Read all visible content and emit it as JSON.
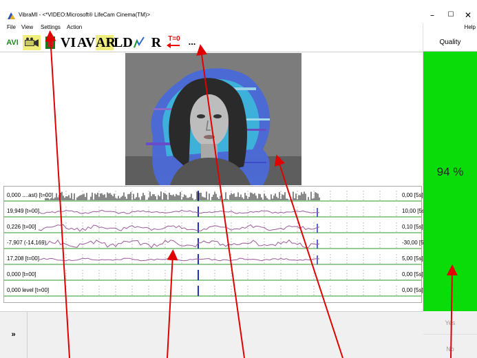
{
  "window": {
    "title": "VibraMI - <*VIDEO:Microsoft® LifeCam Cinema(TM)>",
    "min_glyph": "–",
    "max_glyph": "☐",
    "close_glyph": "✕"
  },
  "menu": {
    "items": [
      "File",
      "View",
      "Settings",
      "Action"
    ],
    "help": "Help"
  },
  "toolbar": {
    "avi": "AVI",
    "vi": "VI",
    "av": "AV",
    "ar": "AR",
    "ld": "LD",
    "r": "R",
    "t0": "T=0",
    "more": "..."
  },
  "quality": {
    "header": "Quality",
    "value": "94 %",
    "color": "#0adc0a"
  },
  "signals": [
    {
      "label": "0,000 ....ast) [t=00]",
      "right": "0,00 [5s]"
    },
    {
      "label": "19,949 [t=00]",
      "right": "10,00 [5s]"
    },
    {
      "label": "0,226 [t=00]",
      "right": "0,10 [5s]"
    },
    {
      "label": "-7,907 (-14,169)",
      "right": "-30,00 [5s]"
    },
    {
      "label": "17,208 [t=00]",
      "right": "5,00 [5s]"
    },
    {
      "label": "0,000 [t=00]",
      "right": "0,00 [5s]"
    },
    {
      "label": "0,000 level [t=00]",
      "right": "0,00 [5s]"
    }
  ],
  "bottom": {
    "expand": "»",
    "yes": "Yes",
    "no": "No"
  },
  "colors": {
    "annotation_arrow": "#e00000",
    "signal_line": "#2a9a2a",
    "signal_trace": "#9a5a9a",
    "marker": "#2030c0",
    "toolbar_selected": "#f0ef7e"
  }
}
